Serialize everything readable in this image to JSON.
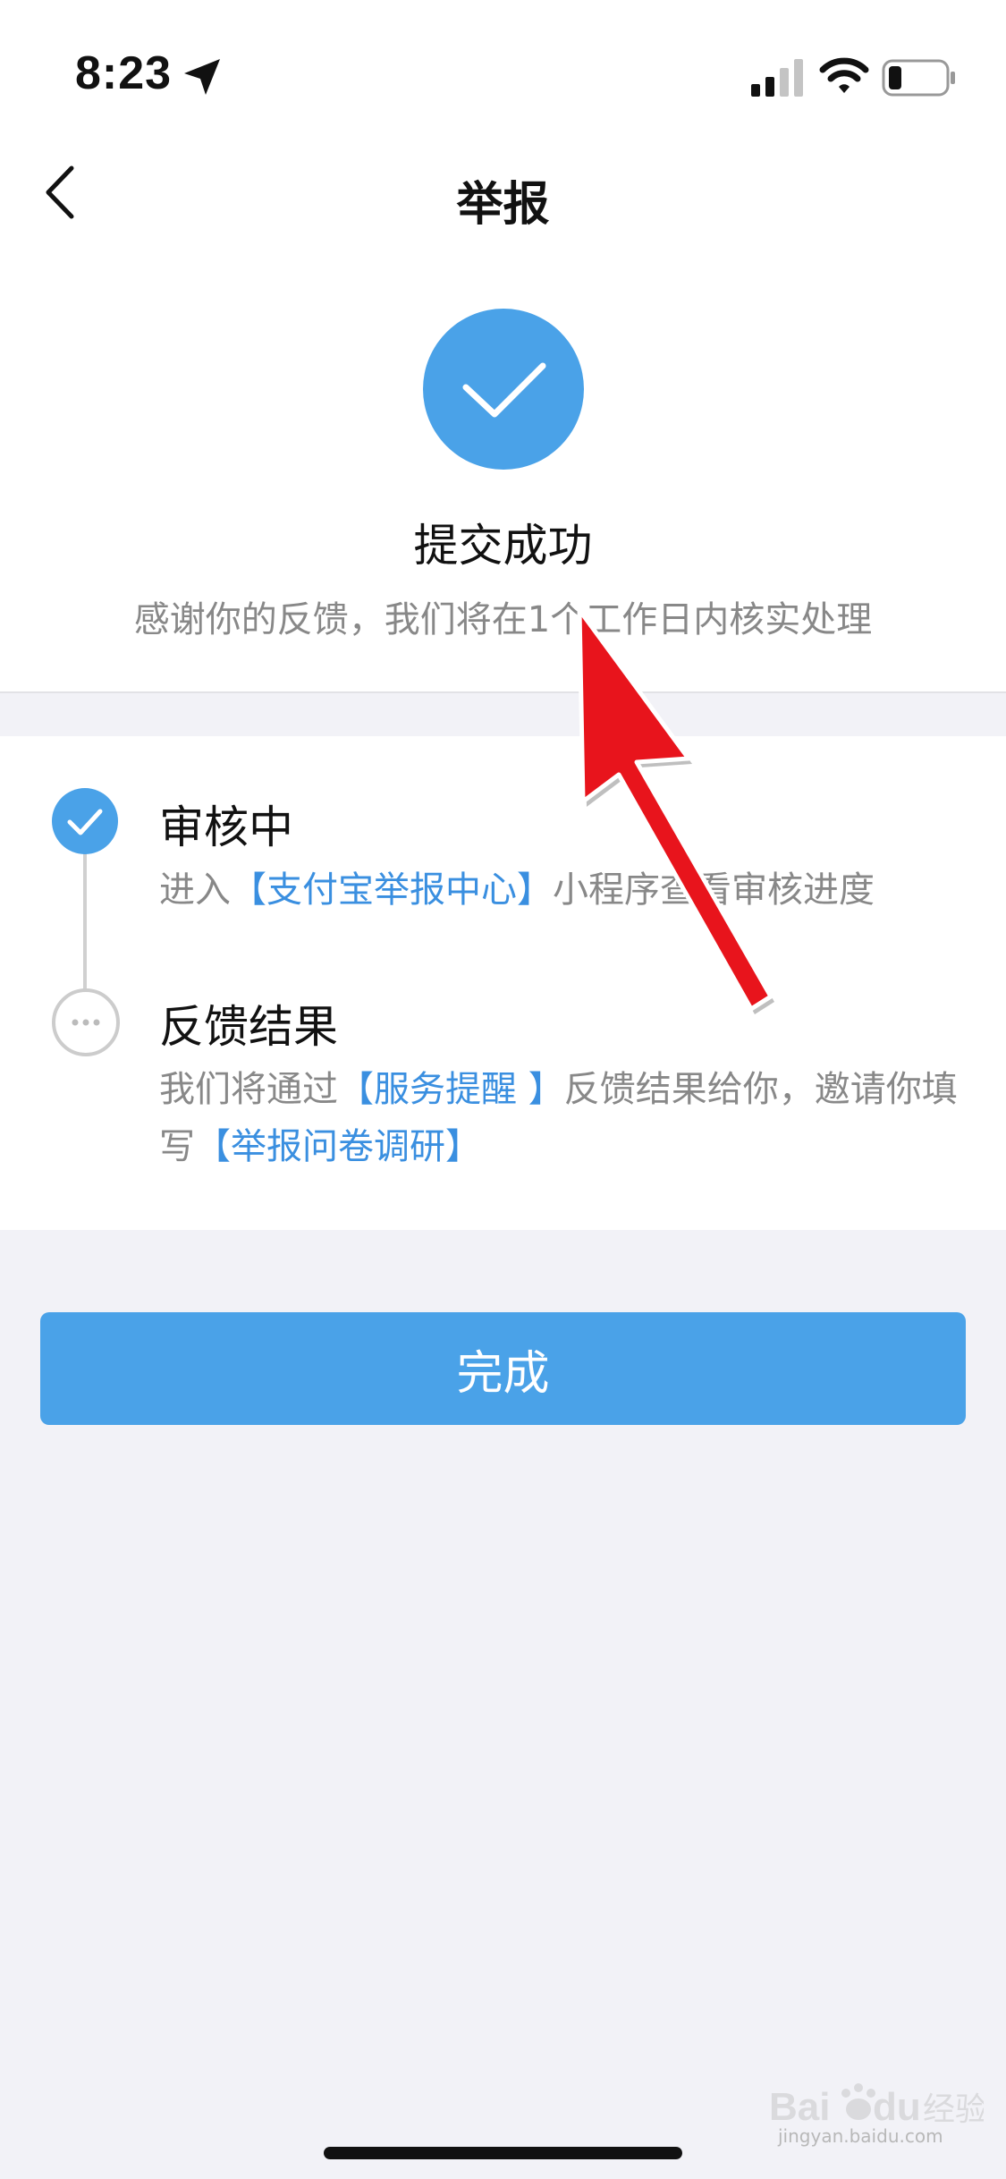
{
  "status_bar": {
    "time": "8:23",
    "icons": [
      "location-arrow-icon",
      "cellular-signal-icon",
      "wifi-icon",
      "battery-icon"
    ]
  },
  "nav": {
    "back_icon": "chevron-left-icon",
    "title": "举报"
  },
  "result": {
    "icon": "check-icon",
    "title": "提交成功",
    "subtitle": "感谢你的反馈，我们将在1个工作日内核实处理"
  },
  "steps": [
    {
      "status": "done",
      "icon": "check-icon",
      "title": "审核中",
      "desc_prefix": "进入",
      "link": "【支付宝举报中心】",
      "desc_suffix": "小程序查看审核进度"
    },
    {
      "status": "pending",
      "icon": "more-dots-icon",
      "title": "反馈结果",
      "desc_prefix": "我们将通过",
      "link": "【服务提醒 】",
      "desc_middle": "反馈结果给你，邀请你填写",
      "link2": "【举报问卷调研】"
    }
  ],
  "done_button": "完成",
  "watermark": {
    "logo_text": "Baidu 经验",
    "url": "jingyan.baidu.com"
  },
  "colors": {
    "accent": "#4aa2e8",
    "link": "#3a8fe0",
    "annotation_arrow": "#e8141c",
    "background": "#f2f2f7"
  }
}
